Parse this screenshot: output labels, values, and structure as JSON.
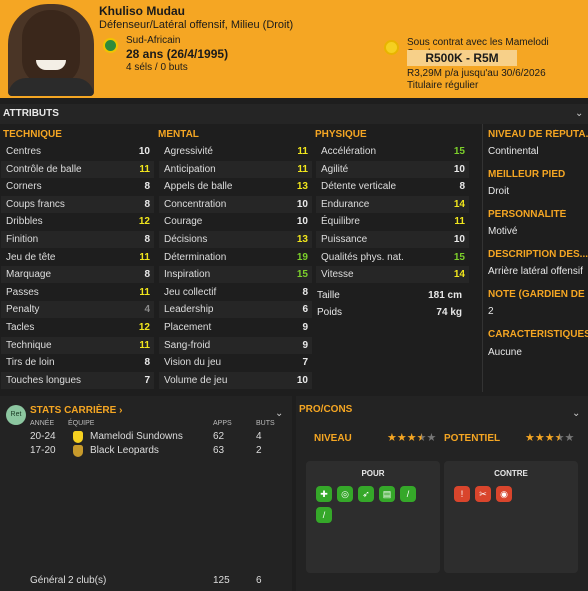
{
  "header": {
    "name": "Khuliso Mudau",
    "positions": "Défenseur/Latéral offensif, Milieu (Droit)",
    "nationality": "Sud-Africain",
    "age": "28 ans (26/4/1995)",
    "caps": "4 séls / 0 buts",
    "contract": "Sous contrat avec les Mamelodi Sundowns",
    "value": "R500K - R5M",
    "wage": "R3,29M p/a jusqu'au 30/6/2026",
    "status": "Titulaire régulier"
  },
  "attributes_label": "ATTRIBUTS",
  "technique": {
    "title": "TECHNIQUE",
    "rows": [
      {
        "label": "Centres",
        "value": "10"
      },
      {
        "label": "Contrôle de balle",
        "value": "11"
      },
      {
        "label": "Corners",
        "value": "8"
      },
      {
        "label": "Coups francs",
        "value": "8"
      },
      {
        "label": "Dribbles",
        "value": "12"
      },
      {
        "label": "Finition",
        "value": "8"
      },
      {
        "label": "Jeu de tête",
        "value": "11"
      },
      {
        "label": "Marquage",
        "value": "8"
      },
      {
        "label": "Passes",
        "value": "11"
      },
      {
        "label": "Penalty",
        "value": "4"
      },
      {
        "label": "Tacles",
        "value": "12"
      },
      {
        "label": "Technique",
        "value": "11"
      },
      {
        "label": "Tirs de loin",
        "value": "8"
      },
      {
        "label": "Touches longues",
        "value": "7"
      }
    ]
  },
  "mental": {
    "title": "MENTAL",
    "rows": [
      {
        "label": "Agressivité",
        "value": "11"
      },
      {
        "label": "Anticipation",
        "value": "11"
      },
      {
        "label": "Appels de balle",
        "value": "13"
      },
      {
        "label": "Concentration",
        "value": "10"
      },
      {
        "label": "Courage",
        "value": "10"
      },
      {
        "label": "Décisions",
        "value": "13"
      },
      {
        "label": "Détermination",
        "value": "19"
      },
      {
        "label": "Inspiration",
        "value": "15"
      },
      {
        "label": "Jeu collectif",
        "value": "8"
      },
      {
        "label": "Leadership",
        "value": "6"
      },
      {
        "label": "Placement",
        "value": "9"
      },
      {
        "label": "Sang-froid",
        "value": "9"
      },
      {
        "label": "Vision du jeu",
        "value": "7"
      },
      {
        "label": "Volume de jeu",
        "value": "10"
      }
    ]
  },
  "physique": {
    "title": "PHYSIQUE",
    "rows": [
      {
        "label": "Accélération",
        "value": "15"
      },
      {
        "label": "Agilité",
        "value": "10"
      },
      {
        "label": "Détente verticale",
        "value": "8"
      },
      {
        "label": "Endurance",
        "value": "14"
      },
      {
        "label": "Équilibre",
        "value": "11"
      },
      {
        "label": "Puissance",
        "value": "10"
      },
      {
        "label": "Qualités phys. nat.",
        "value": "15"
      },
      {
        "label": "Vitesse",
        "value": "14"
      }
    ],
    "height_label": "Taille",
    "height": "181 cm",
    "weight_label": "Poids",
    "weight": "74 kg"
  },
  "side": [
    {
      "title": "NIVEAU DE RÉPUTA...",
      "value": "Continental"
    },
    {
      "title": "MEILLEUR PIED",
      "value": "Droit"
    },
    {
      "title": "PERSONNALITÉ",
      "value": "Motivé"
    },
    {
      "title": "DESCRIPTION DES...",
      "value": "Arrière latéral offensif"
    },
    {
      "title": "NOTE (GARDIEN DE ...",
      "value": "2"
    },
    {
      "title": "CARACTÉRISTIQUES J...",
      "value": "Aucune"
    }
  ],
  "career": {
    "badge": "Ret",
    "title": "STATS CARRIÈRE ›",
    "col_year": "ANNÉE",
    "col_team": "ÉQUIPE",
    "col_apps": "APPS",
    "col_goals": "BUTS",
    "rows": [
      {
        "year": "20-24",
        "team": "Mamelodi Sundowns",
        "apps": "62",
        "goals": "4"
      },
      {
        "year": "17-20",
        "team": "Black Leopards",
        "apps": "63",
        "goals": "2"
      }
    ],
    "total_label": "Général",
    "total_clubs": "2 club(s)",
    "total_apps": "125",
    "total_goals": "6"
  },
  "procons": {
    "title": "PRO/CONS",
    "niveau_label": "NIVEAU",
    "potentiel_label": "POTENTIEL",
    "niveau_stars": 3.5,
    "potentiel_stars": 3.5,
    "pour_label": "POUR",
    "contre_label": "CONTRE",
    "pour_icons": [
      "fitness-icon",
      "target-icon",
      "pass-icon",
      "card-icon",
      "tackle-icon",
      "stamina-icon"
    ],
    "contre_icons": [
      "penalty-icon",
      "leadership-icon",
      "vision-icon"
    ]
  },
  "colors": {
    "accent": "#f5a623",
    "good": "#7ccf2b",
    "mid": "#f1e61c",
    "pro": "#35a829",
    "con": "#d9452c"
  }
}
